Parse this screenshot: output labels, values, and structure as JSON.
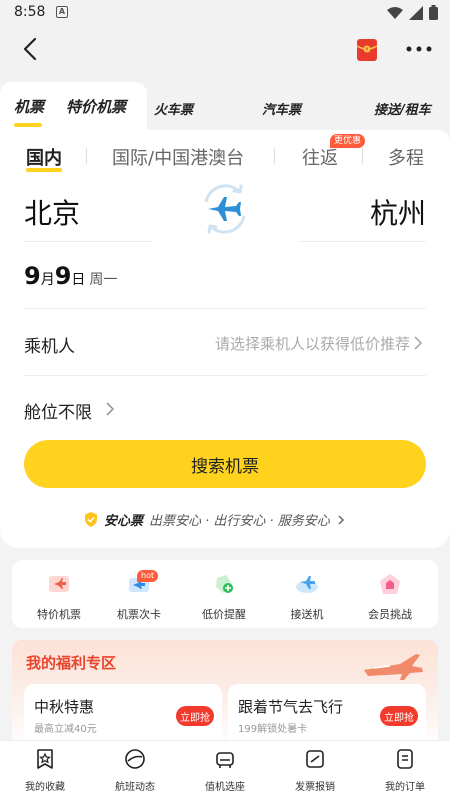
{
  "status_bar": {
    "time": "8:58",
    "a_badge": "A"
  },
  "tabs": [
    {
      "label": "机票"
    },
    {
      "label": "特价机票"
    },
    {
      "label": "火车票"
    },
    {
      "label": "汽车票"
    },
    {
      "label": "接送/租车"
    }
  ],
  "trip_types": [
    {
      "label": "国内"
    },
    {
      "label": "国际/中国港澳台"
    },
    {
      "label": "往返",
      "badge": "更优惠"
    },
    {
      "label": "多程"
    }
  ],
  "route": {
    "from": "北京",
    "to": "杭州"
  },
  "date": {
    "month": "9",
    "month_unit": "月",
    "day": "9",
    "day_unit": "日",
    "weekday": "周一"
  },
  "passenger": {
    "label": "乘机人",
    "hint": "请选择乘机人以获得低价推荐"
  },
  "cabin": {
    "label": "舱位不限"
  },
  "search_button": "搜索机票",
  "assurance": {
    "name": "安心票",
    "desc": "出票安心 · 出行安心 · 服务安心"
  },
  "services": [
    {
      "label": "特价机票",
      "icon": "special-ticket-icon"
    },
    {
      "label": "机票次卡",
      "icon": "ticket-card-icon",
      "badge": "hot"
    },
    {
      "label": "低价提醒",
      "icon": "price-alert-icon"
    },
    {
      "label": "接送机",
      "icon": "airport-transfer-icon"
    },
    {
      "label": "会员挑战",
      "icon": "member-challenge-icon"
    }
  ],
  "welfare": {
    "title": "我的福利专区",
    "promos": [
      {
        "title": "中秋特惠",
        "subtitle": "最高立减40元",
        "button": "立即抢"
      },
      {
        "title": "跟着节气去飞行",
        "subtitle": "199解锁处暑卡",
        "button": "立即抢"
      }
    ]
  },
  "bottom_nav": [
    {
      "label": "我的收藏",
      "icon": "favorites-icon"
    },
    {
      "label": "航班动态",
      "icon": "flight-status-icon"
    },
    {
      "label": "值机选座",
      "icon": "check-in-seat-icon"
    },
    {
      "label": "发票报销",
      "icon": "invoice-icon"
    },
    {
      "label": "我的订单",
      "icon": "orders-icon"
    }
  ],
  "colors": {
    "accent": "#ffd21e",
    "red": "#f23a2c",
    "background": "#f3f3f3"
  }
}
